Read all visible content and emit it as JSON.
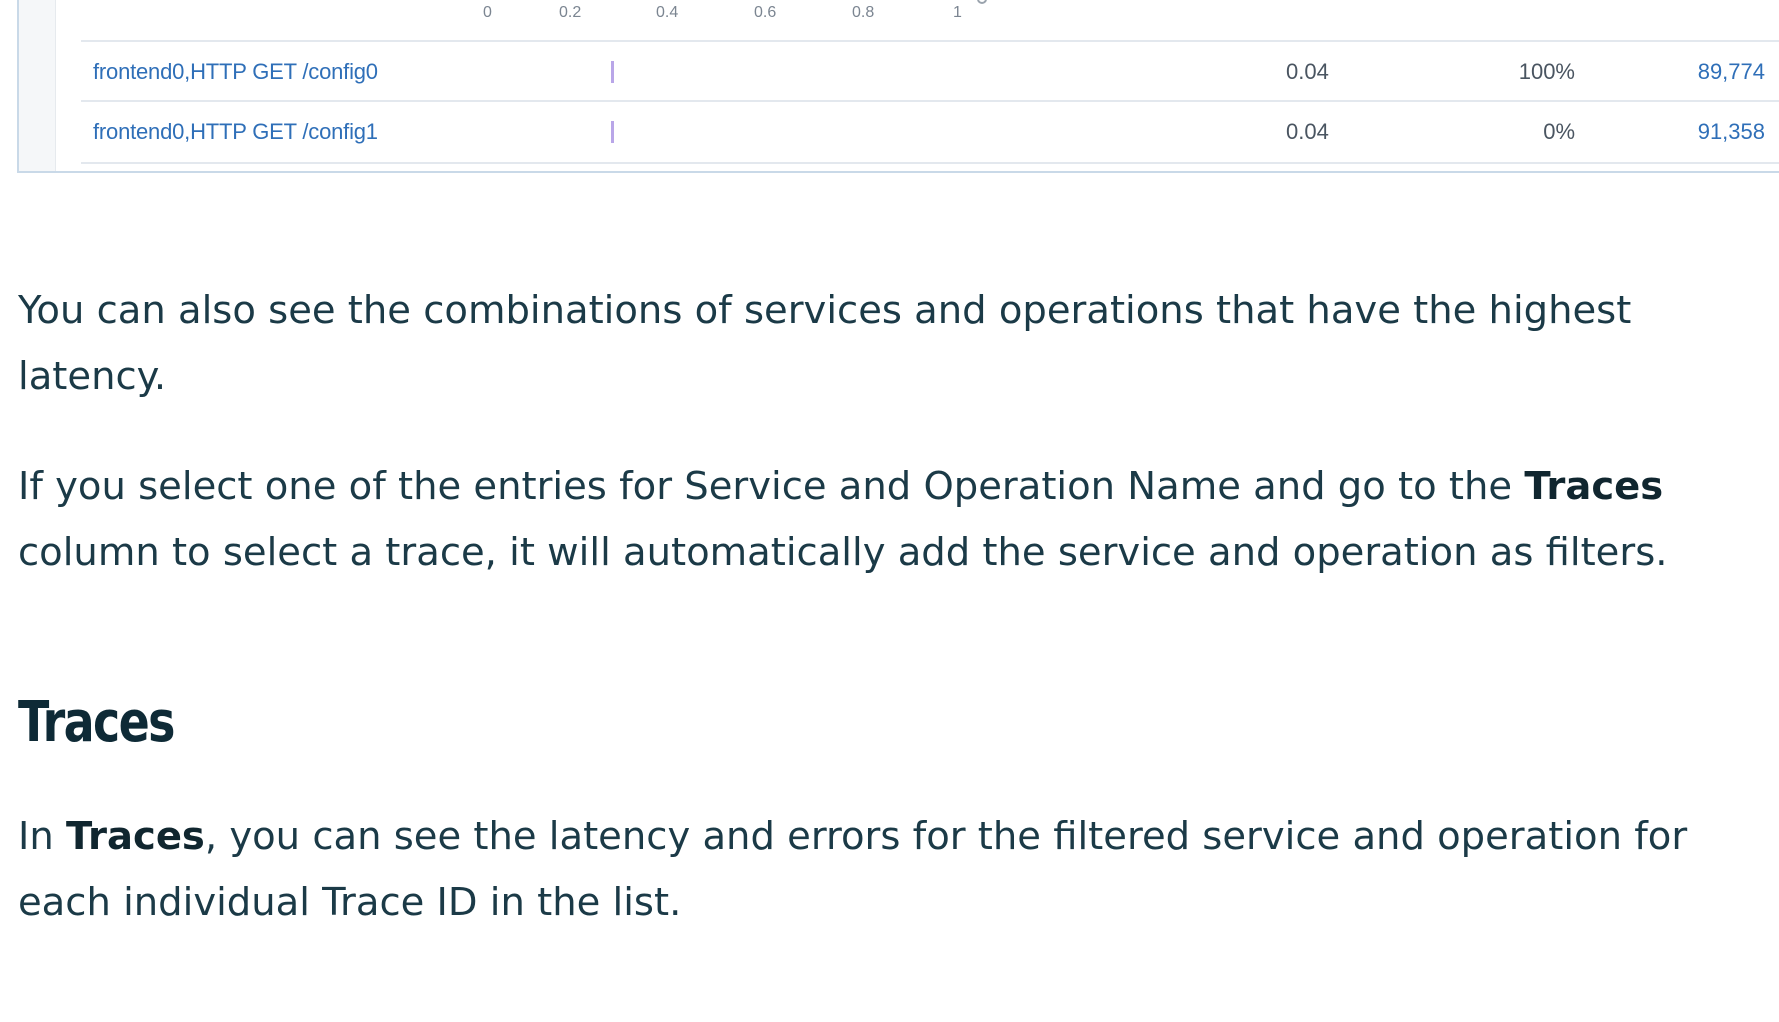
{
  "screenshot": {
    "axis_ticks": [
      "0",
      "0.2",
      "0.4",
      "0.6",
      "0.8",
      "1"
    ],
    "rows": [
      {
        "operation": "frontend0,HTTP GET /config0",
        "latency": "0.04",
        "error_rate": "100%",
        "requests": "89,774"
      },
      {
        "operation": "frontend0,HTTP GET /config1",
        "latency": "0.04",
        "error_rate": "0%",
        "requests": "91,358"
      }
    ]
  },
  "article": {
    "para1": "You can also see the combinations of services and operations that have the highest latency.",
    "para2_before": "If you select one of the entries for Service and Operation Name and go to the ",
    "para2_bold": "Traces",
    "para2_after": " column to select a trace, it will automatically add the service and operation as filters.",
    "heading": "Traces",
    "para3_before": "In ",
    "para3_bold": "Traces",
    "para3_after": ", you can see the latency and errors for the filtered service and operation for each individual Trace ID in the list."
  },
  "colors": {
    "text": "#1b3a47",
    "link": "#2f6fb8",
    "bar": "#b9a6e8",
    "panel_border": "#c9d9e8"
  }
}
